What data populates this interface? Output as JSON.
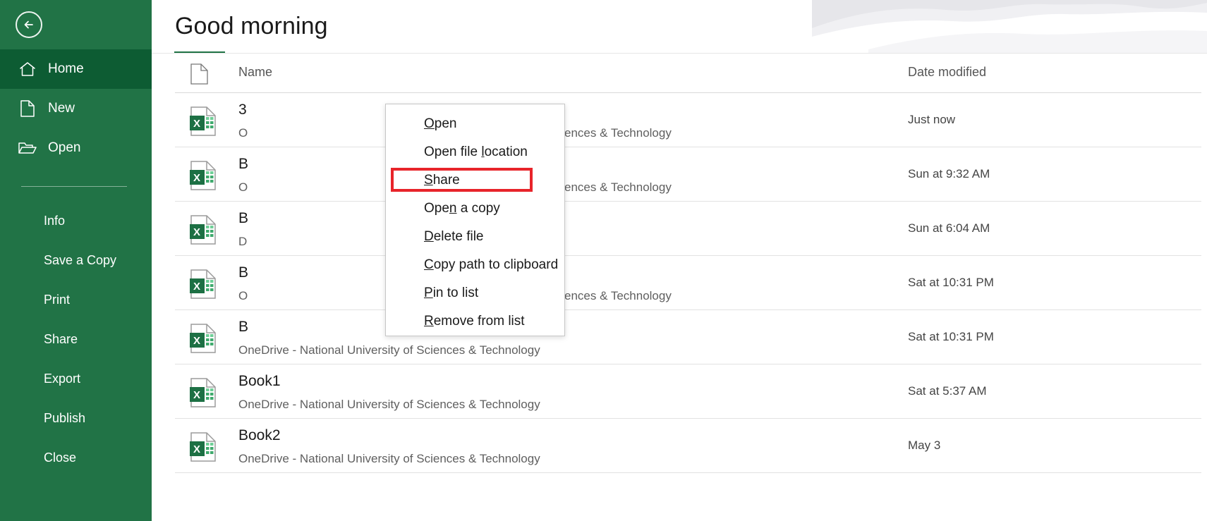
{
  "app": {
    "name": "Excel Backstage",
    "accent_color": "#217346",
    "accent_active_color": "#0d5c33",
    "highlight_color": "#e8242a"
  },
  "sidebar": {
    "back_button": {
      "label": "Back",
      "icon": "back-arrow-circle-icon"
    },
    "main_items": [
      {
        "label": "Home",
        "icon": "home-icon",
        "active": true
      },
      {
        "label": "New",
        "icon": "new-document-icon",
        "active": false
      },
      {
        "label": "Open",
        "icon": "open-folder-icon",
        "active": false
      }
    ],
    "sub_items": [
      {
        "label": "Info"
      },
      {
        "label": "Save a Copy"
      },
      {
        "label": "Print"
      },
      {
        "label": "Share"
      },
      {
        "label": "Export"
      },
      {
        "label": "Publish"
      },
      {
        "label": "Close"
      }
    ]
  },
  "header": {
    "greeting": "Good morning"
  },
  "file_table": {
    "columns": {
      "icon": "document-icon",
      "name": "Name",
      "date_modified": "Date modified"
    },
    "rows": [
      {
        "icon": "excel-file-icon",
        "name": "3",
        "name_truncated": true,
        "subtitle_prefix": "O",
        "subtitle_suffix": "ences & Technology",
        "subtitle_full": "OneDrive - National University of Sciences & Technology",
        "date": "Just now"
      },
      {
        "icon": "excel-file-icon",
        "name": "B",
        "name_truncated": true,
        "subtitle_prefix": "O",
        "subtitle_suffix": "ences & Technology",
        "subtitle_full": "OneDrive - National University of Sciences & Technology",
        "date": "Sun at 9:32 AM"
      },
      {
        "icon": "excel-file-icon",
        "name": "B",
        "name_truncated": true,
        "subtitle_prefix": "D",
        "subtitle_suffix": "",
        "subtitle_full": "D",
        "date": "Sun at 6:04 AM"
      },
      {
        "icon": "excel-file-icon",
        "name": "B",
        "name_truncated": true,
        "subtitle_prefix": "O",
        "subtitle_suffix": "ences & Technology",
        "subtitle_full": "OneDrive - National University of Sciences & Technology",
        "date": "Sat at 10:31 PM"
      },
      {
        "icon": "excel-file-icon",
        "name": "B",
        "name_truncated": true,
        "subtitle_prefix": "OneDrive - National University of Sciences & Technology",
        "subtitle_suffix": "",
        "subtitle_full": "OneDrive - National University of Sciences & Technology",
        "date": "Sat at 10:31 PM"
      },
      {
        "icon": "excel-file-icon",
        "name": "Book1",
        "name_truncated": false,
        "subtitle_prefix": "OneDrive - National University of Sciences & Technology",
        "subtitle_suffix": "",
        "subtitle_full": "OneDrive - National University of Sciences & Technology",
        "date": "Sat at 5:37 AM"
      },
      {
        "icon": "excel-file-icon",
        "name": "Book2",
        "name_truncated": false,
        "subtitle_prefix": "OneDrive - National University of Sciences & Technology",
        "subtitle_suffix": "",
        "subtitle_full": "OneDrive - National University of Sciences & Technology",
        "date": "May 3"
      }
    ]
  },
  "context_menu": {
    "visible": true,
    "items": [
      {
        "label": "Open",
        "accel": "O",
        "accel_index": 0,
        "highlighted": false
      },
      {
        "label": "Open file location",
        "accel": "l",
        "accel_index": 10,
        "highlighted": false
      },
      {
        "label": "Share",
        "accel": "S",
        "accel_index": 0,
        "highlighted": true
      },
      {
        "label": "Open a copy",
        "accel": "n",
        "accel_index": 3,
        "highlighted": false
      },
      {
        "label": "Delete file",
        "accel": "D",
        "accel_index": 0,
        "highlighted": false
      },
      {
        "label": "Copy path to clipboard",
        "accel": "C",
        "accel_index": 0,
        "highlighted": false
      },
      {
        "label": "Pin to list",
        "accel": "P",
        "accel_index": 0,
        "highlighted": false
      },
      {
        "label": "Remove from list",
        "accel": "R",
        "accel_index": 0,
        "highlighted": false
      }
    ]
  }
}
